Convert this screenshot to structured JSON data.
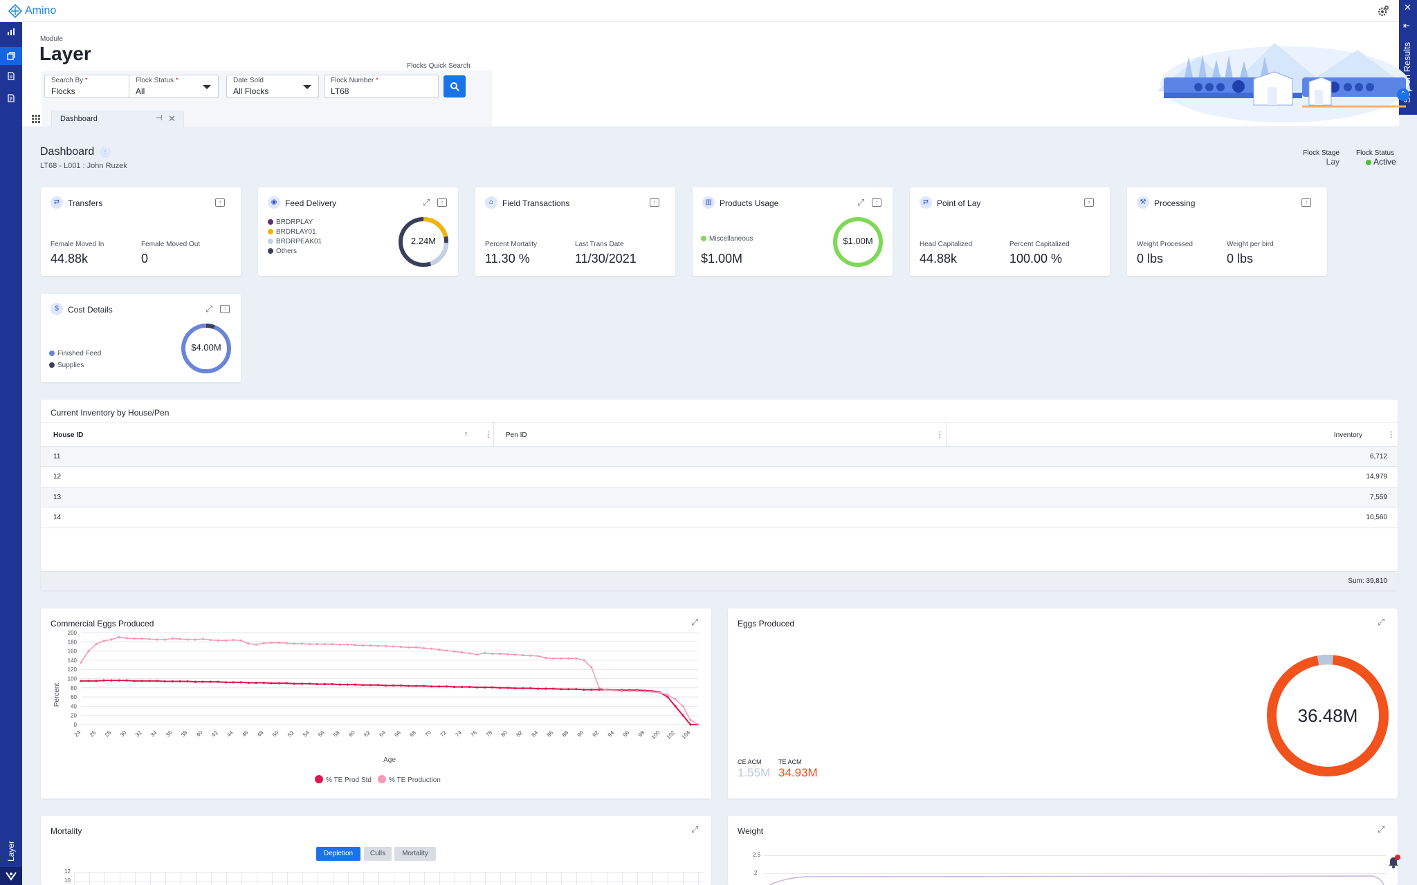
{
  "app": {
    "name": "Amino"
  },
  "sidebar": {
    "module_label": "Layer"
  },
  "search_results_label": "Search Results",
  "header": {
    "module_label": "Module",
    "module_title": "Layer",
    "quick_search_label": "Flocks Quick Search",
    "search_by": {
      "label": "Search By",
      "value": "Flocks"
    },
    "flock_status": {
      "label": "Flock Status",
      "value": "All"
    },
    "date_sold": {
      "label": "Date Sold",
      "value": "All Flocks"
    },
    "flock_number": {
      "label": "Flock Number",
      "value": "LT68"
    }
  },
  "tabs": [
    {
      "label": "Dashboard"
    }
  ],
  "dashboard": {
    "title": "Dashboard",
    "subtitle": "LT68 - L001 : John Ruzek",
    "flock_stage_label": "Flock Stage",
    "flock_stage_value": "Lay",
    "flock_status_label": "Flock Status",
    "flock_status_value": "Active"
  },
  "cards": {
    "transfers": {
      "title": "Transfers",
      "m1_label": "Female Moved In",
      "m1_value": "44.88k",
      "m2_label": "Female Moved Out",
      "m2_value": "0"
    },
    "feed": {
      "title": "Feed Delivery",
      "legend": [
        "BRDRPLAY",
        "BRDRLAY01",
        "BRDRPEAK01",
        "Others"
      ],
      "total": "2.24M"
    },
    "field": {
      "title": "Field Transactions",
      "m1_label": "Percent Mortality",
      "m1_value": "11.30 %",
      "m2_label": "Last Trans Date",
      "m2_value": "11/30/2021"
    },
    "products": {
      "title": "Products Usage",
      "legend": [
        "Miscellaneous"
      ],
      "value": "$1.00M",
      "total": "$1.00M"
    },
    "pol": {
      "title": "Point of Lay",
      "m1_label": "Head Capitalized",
      "m1_value": "44.88k",
      "m2_label": "Percent Capitalized",
      "m2_value": "100.00 %"
    },
    "processing": {
      "title": "Processing",
      "m1_label": "Weight Processed",
      "m1_value": "0 lbs",
      "m2_label": "Weight per bird",
      "m2_value": "0 lbs"
    },
    "cost": {
      "title": "Cost Details",
      "legend": [
        "Finished Feed",
        "Supplies"
      ],
      "total": "$4.00M"
    }
  },
  "inventory": {
    "title": "Current Inventory by House/Pen",
    "columns": [
      "House ID",
      "Pen ID",
      "Inventory"
    ],
    "rows": [
      {
        "house": "11",
        "pen": "",
        "inventory": "6,712"
      },
      {
        "house": "12",
        "pen": "",
        "inventory": "14,979"
      },
      {
        "house": "13",
        "pen": "",
        "inventory": "7,559"
      },
      {
        "house": "14",
        "pen": "",
        "inventory": "10,560"
      }
    ],
    "sum": "Sum: 39,810"
  },
  "eggs_chart": {
    "title": "Eggs Produced",
    "total": "36.48M",
    "ce_label": "CE ACM",
    "ce_value": "1.55M",
    "te_label": "TE ACM",
    "te_value": "34.93M"
  },
  "mortality": {
    "title": "Mortality",
    "buttons": [
      "Depletion",
      "Culls",
      "Mortality"
    ],
    "yticks": [
      "12",
      "10"
    ]
  },
  "weight": {
    "title": "Weight",
    "yticks": [
      "2.5",
      "2"
    ]
  },
  "colors": {
    "brand": "#1f3596",
    "accent": "#1a73e8",
    "prod_std": "#e0154f",
    "production": "#f39ab8",
    "egg_ring": "#f2521c",
    "ce": "#b9c6de"
  },
  "chart_data": {
    "type": "line",
    "title": "Commercial Eggs Produced",
    "xlabel": "Age",
    "ylabel": "Percent",
    "ylim": [
      0,
      200
    ],
    "yticks": [
      0,
      20,
      40,
      60,
      80,
      100,
      120,
      140,
      160,
      180,
      200
    ],
    "xticks": [
      24,
      26,
      28,
      30,
      32,
      34,
      36,
      38,
      40,
      42,
      44,
      46,
      48,
      50,
      52,
      54,
      56,
      58,
      60,
      62,
      64,
      66,
      68,
      70,
      72,
      74,
      76,
      78,
      80,
      82,
      84,
      86,
      88,
      90,
      92,
      94,
      96,
      98,
      100,
      102,
      104
    ],
    "x": [
      24,
      25,
      26,
      27,
      28,
      29,
      30,
      31,
      32,
      33,
      34,
      35,
      36,
      37,
      38,
      39,
      40,
      41,
      42,
      43,
      44,
      45,
      46,
      47,
      48,
      49,
      50,
      51,
      52,
      53,
      54,
      55,
      56,
      57,
      58,
      59,
      60,
      61,
      62,
      63,
      64,
      65,
      66,
      67,
      68,
      69,
      70,
      71,
      72,
      73,
      74,
      75,
      76,
      77,
      78,
      79,
      80,
      81,
      82,
      83,
      84,
      85,
      86,
      87,
      88,
      89,
      90,
      91,
      92,
      93,
      94,
      95,
      96,
      97,
      98,
      99,
      100,
      101,
      102,
      103,
      104,
      105
    ],
    "series": [
      {
        "name": "% TE Prod Std",
        "values": [
          95,
          95,
          95,
          96,
          96,
          96,
          96,
          95,
          95,
          95,
          95,
          94,
          94,
          94,
          94,
          93,
          93,
          93,
          93,
          92,
          92,
          92,
          91,
          91,
          91,
          90,
          90,
          90,
          89,
          89,
          89,
          88,
          88,
          88,
          87,
          87,
          87,
          86,
          86,
          86,
          85,
          85,
          85,
          84,
          84,
          84,
          83,
          83,
          83,
          82,
          82,
          82,
          81,
          81,
          81,
          80,
          80,
          79,
          79,
          79,
          78,
          78,
          78,
          77,
          77,
          77,
          76,
          76,
          76,
          76,
          75,
          75,
          75,
          75,
          74,
          73,
          70,
          60,
          40,
          20,
          0,
          0
        ]
      },
      {
        "name": "% TE Production",
        "values": [
          135,
          160,
          175,
          182,
          185,
          190,
          188,
          187,
          187,
          186,
          185,
          185,
          187,
          186,
          185,
          185,
          186,
          184,
          183,
          183,
          184,
          183,
          176,
          174,
          177,
          178,
          178,
          177,
          176,
          176,
          175,
          175,
          175,
          175,
          174,
          174,
          173,
          172,
          172,
          171,
          171,
          170,
          169,
          168,
          168,
          166,
          165,
          163,
          161,
          159,
          157,
          155,
          152,
          156,
          154,
          154,
          153,
          152,
          151,
          150,
          149,
          145,
          144,
          144,
          144,
          144,
          140,
          125,
          80,
          75,
          74,
          73,
          73,
          73,
          72,
          71,
          69,
          65,
          55,
          40,
          10,
          0
        ]
      }
    ],
    "legend": "bottom-center",
    "grid": true
  }
}
